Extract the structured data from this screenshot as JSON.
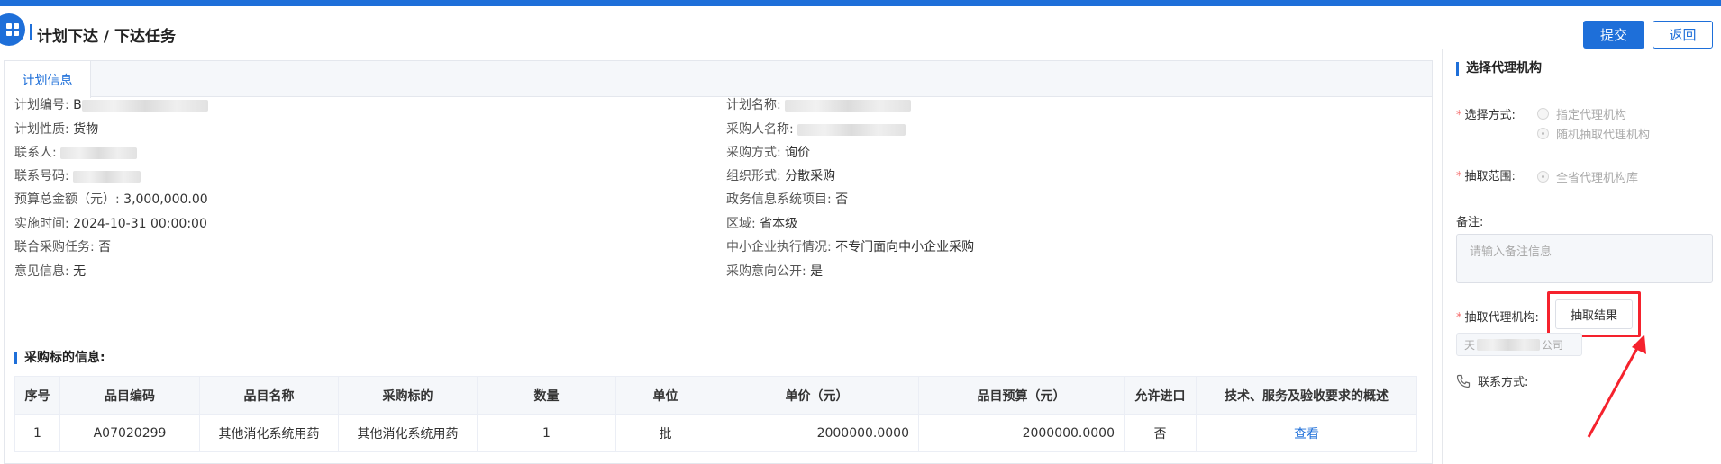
{
  "header": {
    "breadcrumb": "计划下达 / 下达任务",
    "submit_label": "提交",
    "back_label": "返回"
  },
  "tabs": [
    {
      "label": "计划信息"
    }
  ],
  "plan": {
    "left": [
      {
        "label": "计划编号:",
        "value": "B"
      },
      {
        "label": "计划性质:",
        "value": "货物"
      },
      {
        "label": "联系人:",
        "value": ""
      },
      {
        "label": "联系号码:",
        "value": ""
      },
      {
        "label": "预算总金额（元）:",
        "value": "3,000,000.00"
      },
      {
        "label": "实施时间:",
        "value": "2024-10-31 00:00:00"
      },
      {
        "label": "联合采购任务:",
        "value": "否"
      },
      {
        "label": "意见信息:",
        "value": "无"
      }
    ],
    "right": [
      {
        "label": "计划名称:",
        "value": ""
      },
      {
        "label": "采购人名称:",
        "value": ""
      },
      {
        "label": "采购方式:",
        "value": "询价"
      },
      {
        "label": "组织形式:",
        "value": "分散采购"
      },
      {
        "label": "政务信息系统项目:",
        "value": "否"
      },
      {
        "label": "区域:",
        "value": "省本级"
      },
      {
        "label": "中小企业执行情况:",
        "value": "不专门面向中小企业采购"
      },
      {
        "label": "采购意向公开:",
        "value": "是"
      }
    ]
  },
  "items_section": {
    "title": "采购标的信息:",
    "columns": [
      "序号",
      "品目编码",
      "品目名称",
      "采购标的",
      "数量",
      "单位",
      "单价（元）",
      "品目预算（元）",
      "允许进口",
      "技术、服务及验收要求的概述"
    ],
    "rows": [
      [
        "1",
        "A07020299",
        "其他消化系统用药",
        "其他消化系统用药",
        "1",
        "批",
        "2000000.0000",
        "2000000.0000",
        "否",
        "查看"
      ]
    ]
  },
  "sidebar": {
    "title": "选择代理机构",
    "select_method_label": "选择方式:",
    "option_assign": "指定代理机构",
    "option_random": "随机抽取代理机构",
    "scope_label": "抽取范围:",
    "scope_option": "全省代理机构库",
    "remark_label": "备注:",
    "remark_placeholder": "请输入备注信息",
    "agency_label": "抽取代理机构:",
    "draw_button": "抽取结果",
    "result_prefix": "天",
    "result_suffix": "公司",
    "contact_label": "联系方式:"
  },
  "colors": {
    "accent": "#1e6fd9",
    "highlight": "#f5222d"
  }
}
